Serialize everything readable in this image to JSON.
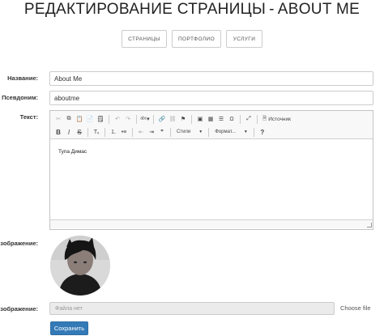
{
  "page": {
    "title_main": "РЕДАКТИРОВАНИЕ СТРАНИЦЫ",
    "title_sep": "-",
    "title_sub": "ABOUT ME"
  },
  "topnav": [
    {
      "label": "СТРАНИЦЫ"
    },
    {
      "label": "ПОРТФОЛИО"
    },
    {
      "label": "УСЛУГИ"
    }
  ],
  "form": {
    "name_label": "Название:",
    "name_value": "About Me",
    "alias_label": "Псевдоним:",
    "alias_value": "aboutme",
    "text_label": "Текст:",
    "image_label": "Изображение:",
    "image_upload_label": "Изображение:",
    "file_placeholder": "Файла нет",
    "choose_file": "Choose file",
    "save_label": "Сохранить"
  },
  "editor": {
    "content": "Тупа Димас",
    "styles_label": "Стили",
    "format_label": "Формат...",
    "source_label": "Источник",
    "bold": "B",
    "italic": "I",
    "strike": "S",
    "help": "?"
  }
}
